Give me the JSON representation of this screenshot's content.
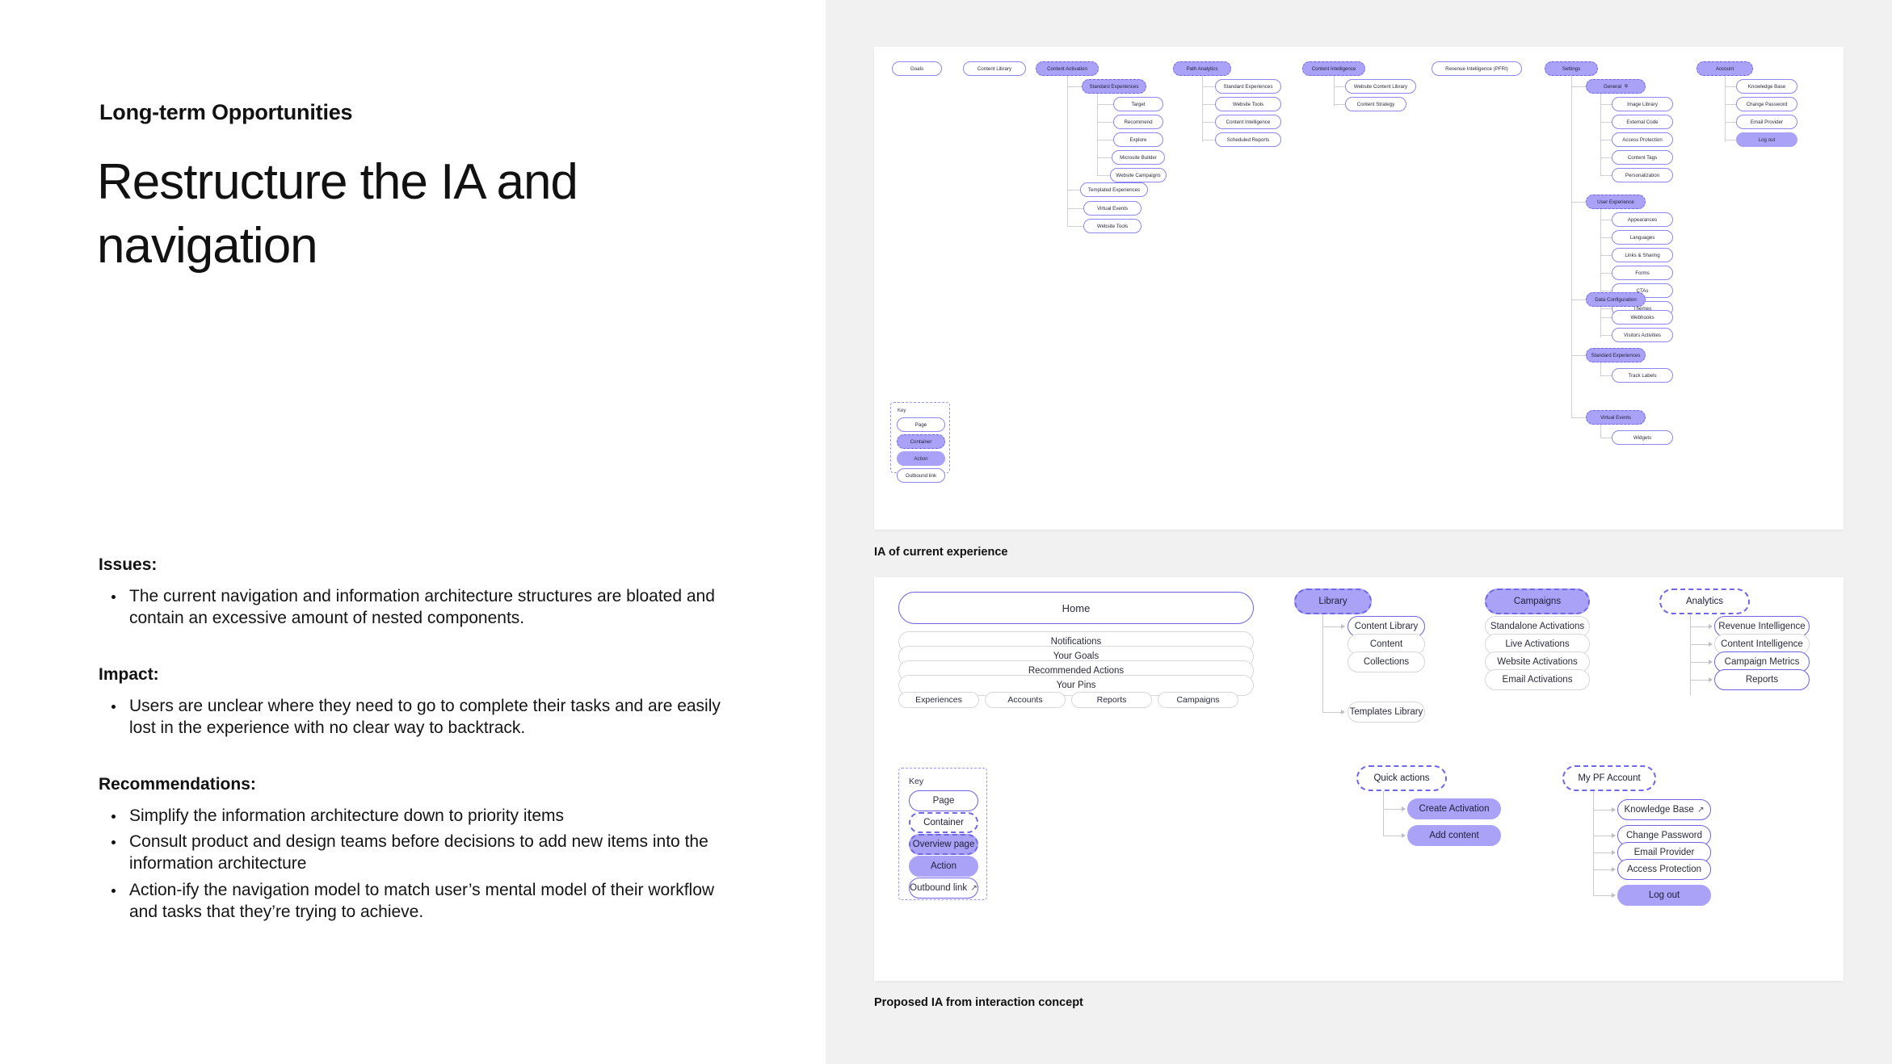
{
  "left": {
    "eyebrow": "Long-term Opportunities",
    "headline": "Restructure the IA and navigation",
    "issues_heading": "Issues:",
    "issues": [
      "The current navigation and information architecture structures are bloated and contain an excessive amount of nested components."
    ],
    "impact_heading": "Impact:",
    "impact": [
      "Users are unclear where they need to go to complete their tasks and are easily lost in the experience with no clear way to backtrack."
    ],
    "recommendations_heading": "Recommendations:",
    "recommendations": [
      "Simplify the information architecture down to priority items",
      "Consult product and design teams before decisions to add new items into the information architecture",
      "Action-ify the navigation model to match user’s mental model of their workflow and tasks that they’re trying to achieve."
    ]
  },
  "colors": {
    "accent_fill": "#a9a2f7",
    "accent_border": "#6f66e8",
    "page_border": "#8d86f0",
    "canvas_bg": "#f1f1f1",
    "line": "#c9c9cf"
  },
  "diagram_current": {
    "caption": "IA of current experience",
    "columns": [
      {
        "root": "Goals",
        "type": "page",
        "children": []
      },
      {
        "root": "Content Library",
        "type": "page",
        "children": []
      },
      {
        "root": "Content Activation",
        "type": "container",
        "children": [
          {
            "label": "Standard Experiences",
            "type": "container",
            "children": [
              "Target",
              "Recommend",
              "Explore",
              "Microsite Builder",
              "Website Campaigns"
            ]
          },
          {
            "label": "Templated Experiences",
            "type": "page",
            "children": []
          },
          {
            "label": "Virtual Events",
            "type": "page",
            "children": []
          },
          {
            "label": "Website Tools",
            "type": "page",
            "children": []
          }
        ]
      },
      {
        "root": "Path Analytics",
        "type": "container",
        "children": [
          {
            "label": "Standard Experiences",
            "type": "page",
            "children": []
          },
          {
            "label": "Website Tools",
            "type": "page",
            "children": []
          },
          {
            "label": "Content Intelligence",
            "type": "page",
            "children": []
          },
          {
            "label": "Scheduled Reports",
            "type": "page",
            "children": []
          }
        ]
      },
      {
        "root": "Content Intelligence",
        "type": "container",
        "children": [
          {
            "label": "Website Content Library",
            "type": "page",
            "children": []
          },
          {
            "label": "Content Strategy",
            "type": "page",
            "children": []
          }
        ]
      },
      {
        "root": "Revenue Intelligence (PFRI)",
        "type": "page",
        "children": []
      },
      {
        "root": "Settings",
        "type": "container",
        "children": [
          {
            "label": "General",
            "type": "container",
            "outbound": true,
            "children": [
              "Image Library",
              "External Code",
              "Access Protection",
              "Content Tags",
              "Personalization"
            ]
          },
          {
            "label": "User Experience",
            "type": "container",
            "children": [
              "Appearances",
              "Languages",
              "Links & Sharing",
              "Forms",
              "CTAs",
              "Themes"
            ]
          },
          {
            "label": "Data Configuration",
            "type": "container",
            "children": [
              "Webhooks",
              "Visitors Activities"
            ]
          },
          {
            "label": "Standard Experiences",
            "type": "container",
            "children": [
              "Track Labels"
            ]
          },
          {
            "label": "Virtual Events",
            "type": "container",
            "children": [
              "Widgets"
            ]
          }
        ]
      },
      {
        "root": "Account",
        "type": "container",
        "children": [
          {
            "label": "Knowledge Base",
            "type": "page",
            "children": []
          },
          {
            "label": "Change Password",
            "type": "page",
            "children": []
          },
          {
            "label": "Email Provider",
            "type": "page",
            "children": []
          },
          {
            "label": "Log out",
            "type": "action",
            "children": []
          }
        ]
      }
    ],
    "key": {
      "title": "Key",
      "items": [
        {
          "label": "Page",
          "type": "page"
        },
        {
          "label": "Container",
          "type": "container"
        },
        {
          "label": "Action",
          "type": "action"
        },
        {
          "label": "Outbound link",
          "type": "page"
        }
      ]
    }
  },
  "diagram_proposed": {
    "caption": "Proposed IA from interaction concept",
    "home": {
      "root": "Home",
      "rows": [
        "Notifications",
        "Your Goals",
        "Recommended Actions",
        "Your Pins"
      ],
      "tabs": [
        "Experiences",
        "Accounts",
        "Reports",
        "Campaigns"
      ]
    },
    "library": {
      "root": "Library",
      "children": [
        "Content Library",
        "Content",
        "Collections",
        "Templates Library"
      ]
    },
    "campaigns": {
      "root": "Campaigns",
      "children": [
        "Standalone Activations",
        "Live Activations",
        "Website Activations",
        "Email Activations"
      ]
    },
    "analytics": {
      "root": "Analytics",
      "children": [
        "Revenue Intelligence",
        "Content Intelligence",
        "Campaign Metrics",
        "Reports"
      ]
    },
    "quick_actions": {
      "root": "Quick actions",
      "children": [
        "Create Activation",
        "Add content"
      ]
    },
    "account": {
      "root": "My PF Account",
      "children": [
        "Knowledge Base",
        "Change Password",
        "Email Provider",
        "Access Protection",
        "Log out"
      ]
    },
    "key": {
      "title": "Key",
      "items": [
        {
          "label": "Page",
          "type": "page"
        },
        {
          "label": "Container",
          "type": "container-outline"
        },
        {
          "label": "Overview page",
          "type": "overview-filled"
        },
        {
          "label": "Action",
          "type": "action"
        },
        {
          "label": "Outbound link",
          "type": "outbound"
        }
      ]
    }
  }
}
